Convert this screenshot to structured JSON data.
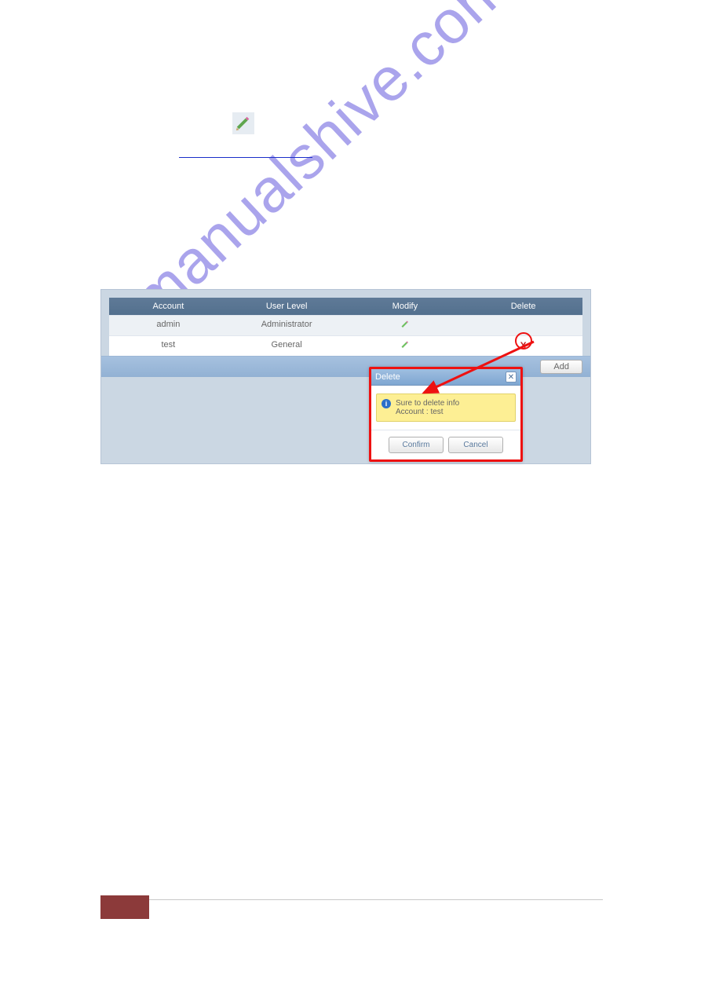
{
  "watermark": "manualshive.com",
  "table": {
    "headers": [
      "Account",
      "User Level",
      "Modify",
      "Delete"
    ],
    "rows": [
      {
        "account": "admin",
        "level": "Administrator",
        "deletable": false
      },
      {
        "account": "test",
        "level": "General",
        "deletable": true
      }
    ]
  },
  "toolbar": {
    "add_label": "Add"
  },
  "dialog": {
    "title": "Delete",
    "line1": "Sure to delete info",
    "line2": "Account :  test",
    "confirm_label": "Confirm",
    "cancel_label": "Cancel"
  }
}
